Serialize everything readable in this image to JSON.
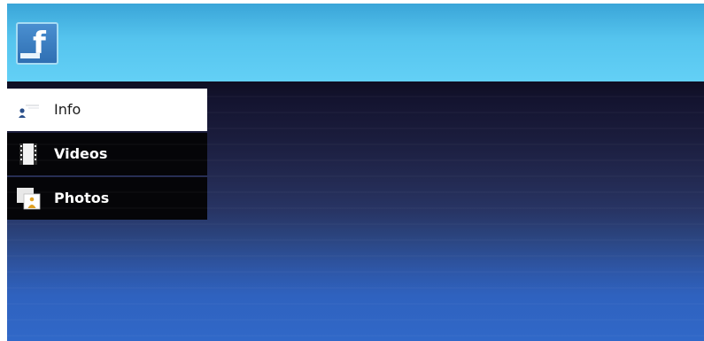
{
  "app": {
    "logo_icon": "facebook-icon",
    "logo_letter": "f"
  },
  "menu": {
    "items": [
      {
        "label": "Info",
        "icon": "contact-card-icon",
        "selected": true
      },
      {
        "label": "Videos",
        "icon": "film-strip-icon",
        "selected": false
      },
      {
        "label": "Photos",
        "icon": "photo-stack-icon",
        "selected": false
      }
    ]
  },
  "colors": {
    "header": "#55c4ee",
    "logo": "#3b79bd",
    "menu_background": "#050508",
    "menu_selected": "#ffffff",
    "background_bottom": "#3068c8"
  }
}
